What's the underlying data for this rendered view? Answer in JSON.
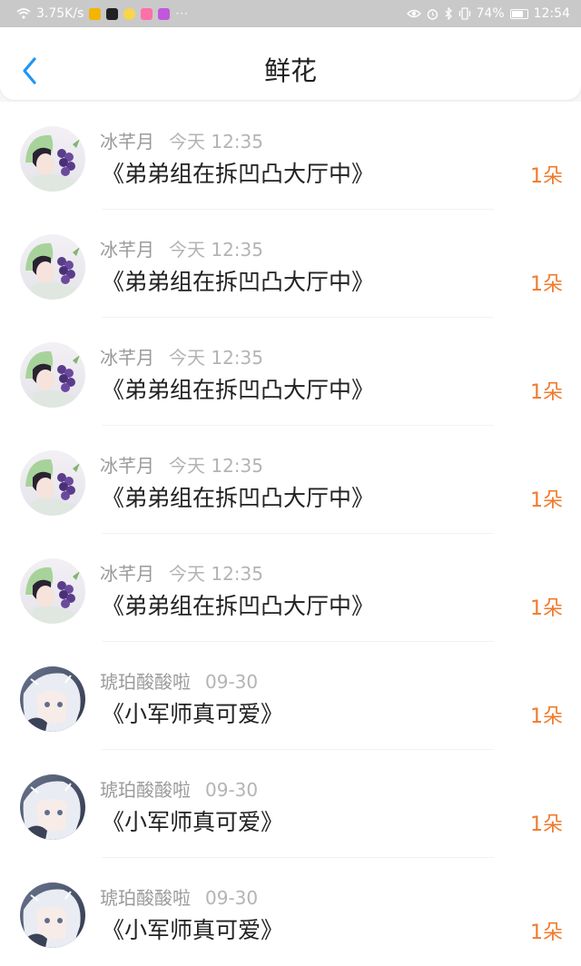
{
  "status_bar": {
    "speed": "3.75K/s",
    "dots": "···",
    "battery": "74%",
    "time": "12:54"
  },
  "header": {
    "back_icon": "chevron-left-icon",
    "title": "鲜花"
  },
  "colors": {
    "accent_blue": "#2196f3",
    "count_orange": "#f07a2c",
    "meta_gray": "#9a9a9a"
  },
  "rows": [
    {
      "avatar": "avatar-girl-grapes",
      "user": "冰芊月",
      "time": "今天 12:35",
      "text": "《弟弟组在拆凹凸大厅中》",
      "count": "1朵"
    },
    {
      "avatar": "avatar-girl-grapes",
      "user": "冰芊月",
      "time": "今天 12:35",
      "text": "《弟弟组在拆凹凸大厅中》",
      "count": "1朵"
    },
    {
      "avatar": "avatar-girl-grapes",
      "user": "冰芊月",
      "time": "今天 12:35",
      "text": "《弟弟组在拆凹凸大厅中》",
      "count": "1朵"
    },
    {
      "avatar": "avatar-girl-grapes",
      "user": "冰芊月",
      "time": "今天 12:35",
      "text": "《弟弟组在拆凹凸大厅中》",
      "count": "1朵"
    },
    {
      "avatar": "avatar-girl-grapes",
      "user": "冰芊月",
      "time": "今天 12:35",
      "text": "《弟弟组在拆凹凸大厅中》",
      "count": "1朵"
    },
    {
      "avatar": "avatar-silver-hair",
      "user": "琥珀酸酸啦",
      "time": "09-30",
      "text": "《小军师真可爱》",
      "count": "1朵"
    },
    {
      "avatar": "avatar-silver-hair",
      "user": "琥珀酸酸啦",
      "time": "09-30",
      "text": "《小军师真可爱》",
      "count": "1朵"
    },
    {
      "avatar": "avatar-silver-hair",
      "user": "琥珀酸酸啦",
      "time": "09-30",
      "text": "《小军师真可爱》",
      "count": "1朵"
    }
  ]
}
